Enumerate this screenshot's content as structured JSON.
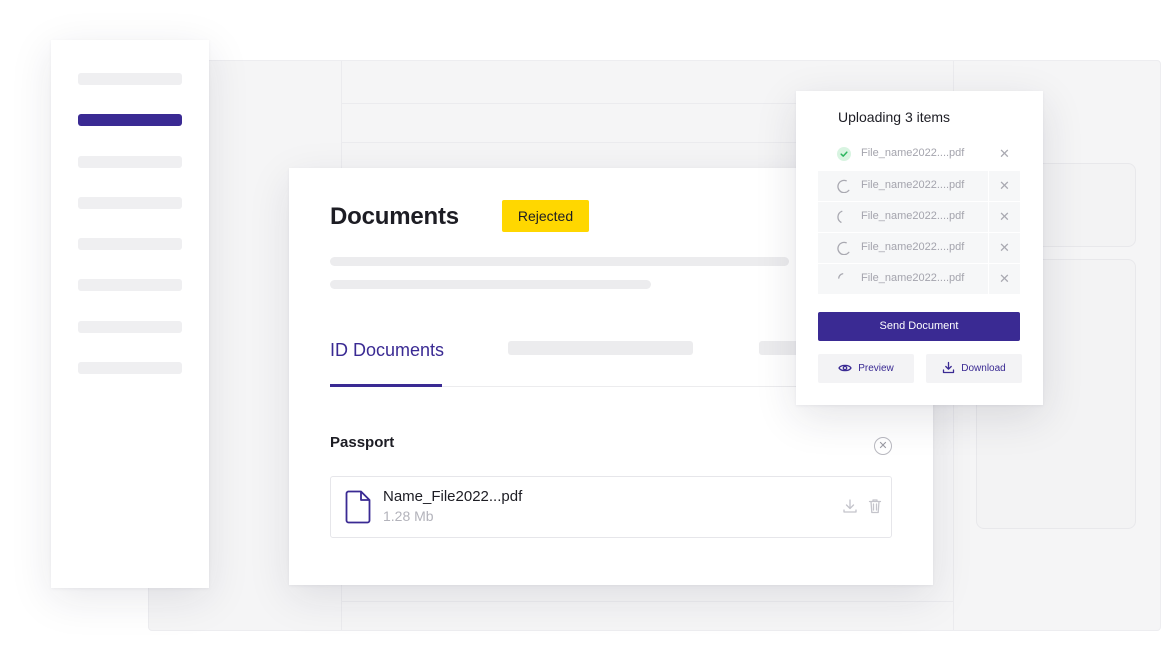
{
  "main": {
    "title": "Documents",
    "status_badge": "Rejected",
    "tabs": [
      {
        "label": "ID Documents",
        "active": true
      }
    ],
    "section": {
      "title": "Passport",
      "file": {
        "name": "Name_File2022...pdf",
        "size": "1.28 Mb",
        "icon": "file-icon"
      }
    }
  },
  "upload": {
    "title": "Uploading 3 items",
    "items": [
      {
        "name": "File_name2022....pdf",
        "status": "done"
      },
      {
        "name": "File_name2022....pdf",
        "status": "uploading"
      },
      {
        "name": "File_name2022....pdf",
        "status": "uploading"
      },
      {
        "name": "File_name2022....pdf",
        "status": "uploading"
      },
      {
        "name": "File_name2022....pdf",
        "status": "uploading"
      }
    ],
    "send_label": "Send Document",
    "preview_label": "Preview",
    "download_label": "Download"
  },
  "colors": {
    "accent": "#3a2a93",
    "badge": "#ffd700",
    "success": "#2bb55e"
  }
}
